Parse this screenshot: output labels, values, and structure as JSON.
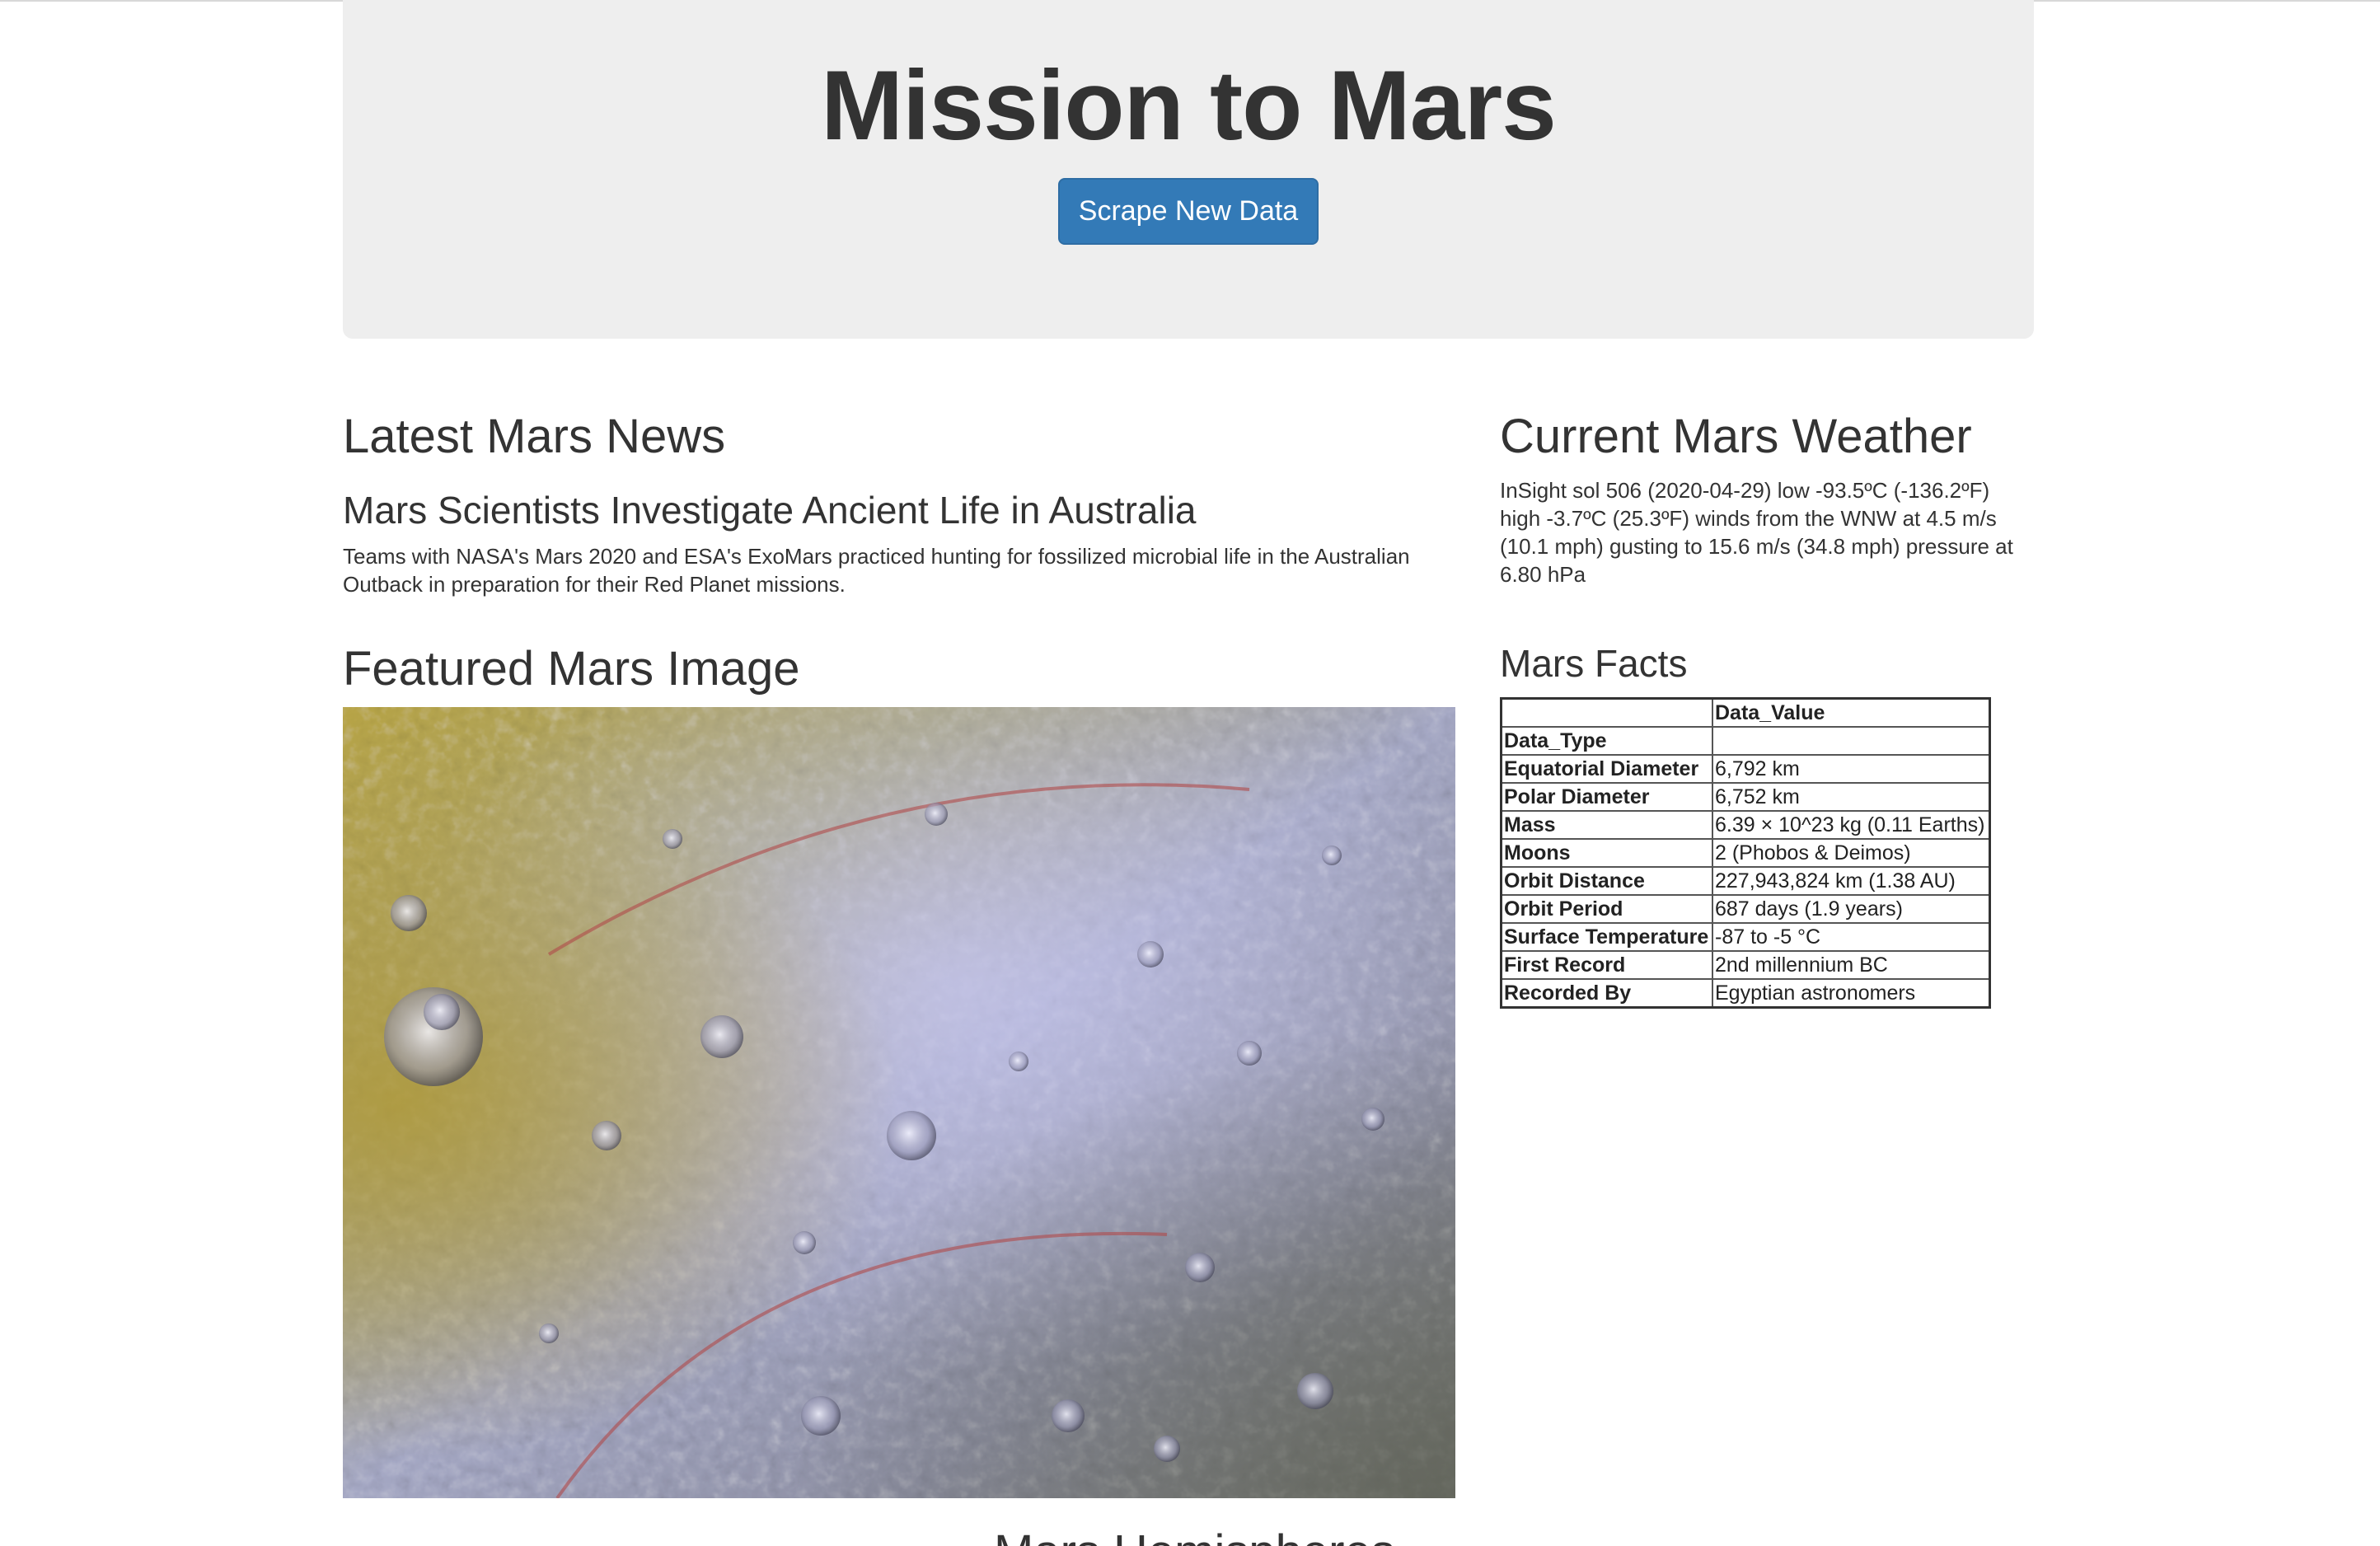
{
  "header": {
    "title": "Mission to Mars",
    "scrape_button_label": "Scrape New Data"
  },
  "news": {
    "heading": "Latest Mars News",
    "title": "Mars Scientists Investigate Ancient Life in Australia",
    "paragraph": "Teams with NASA's Mars 2020 and ESA's ExoMars practiced hunting for fossilized microbial life in the Australian Outback in preparation for their Red Planet missions."
  },
  "featured": {
    "heading": "Featured Mars Image"
  },
  "weather": {
    "heading": "Current Mars Weather",
    "text": "InSight sol 506 (2020-04-29) low -93.5ºC (-136.2ºF) high -3.7ºC (25.3ºF) winds from the WNW at 4.5 m/s (10.1 mph) gusting to 15.6 m/s (34.8 mph) pressure at 6.80 hPa"
  },
  "facts": {
    "heading": "Mars Facts",
    "value_header": "Data_Value",
    "index_header": "Data_Type",
    "rows": [
      {
        "label": "Equatorial Diameter",
        "value": "6,792 km"
      },
      {
        "label": "Polar Diameter",
        "value": "6,752 km"
      },
      {
        "label": "Mass",
        "value": "6.39 × 10^23 kg (0.11 Earths)"
      },
      {
        "label": "Moons",
        "value": "2 (Phobos & Deimos)"
      },
      {
        "label": "Orbit Distance",
        "value": "227,943,824 km (1.38 AU)"
      },
      {
        "label": "Orbit Period",
        "value": "687 days (1.9 years)"
      },
      {
        "label": "Surface Temperature",
        "value": "-87 to -5 °C"
      },
      {
        "label": "First Record",
        "value": "2nd millennium BC"
      },
      {
        "label": "Recorded By",
        "value": "Egyptian astronomers"
      }
    ]
  },
  "hemispheres": {
    "heading": "Mars Hemispheres"
  },
  "colors": {
    "jumbotron_bg": "#eeeeee",
    "button_primary": "#337ab7",
    "text": "#333333"
  }
}
